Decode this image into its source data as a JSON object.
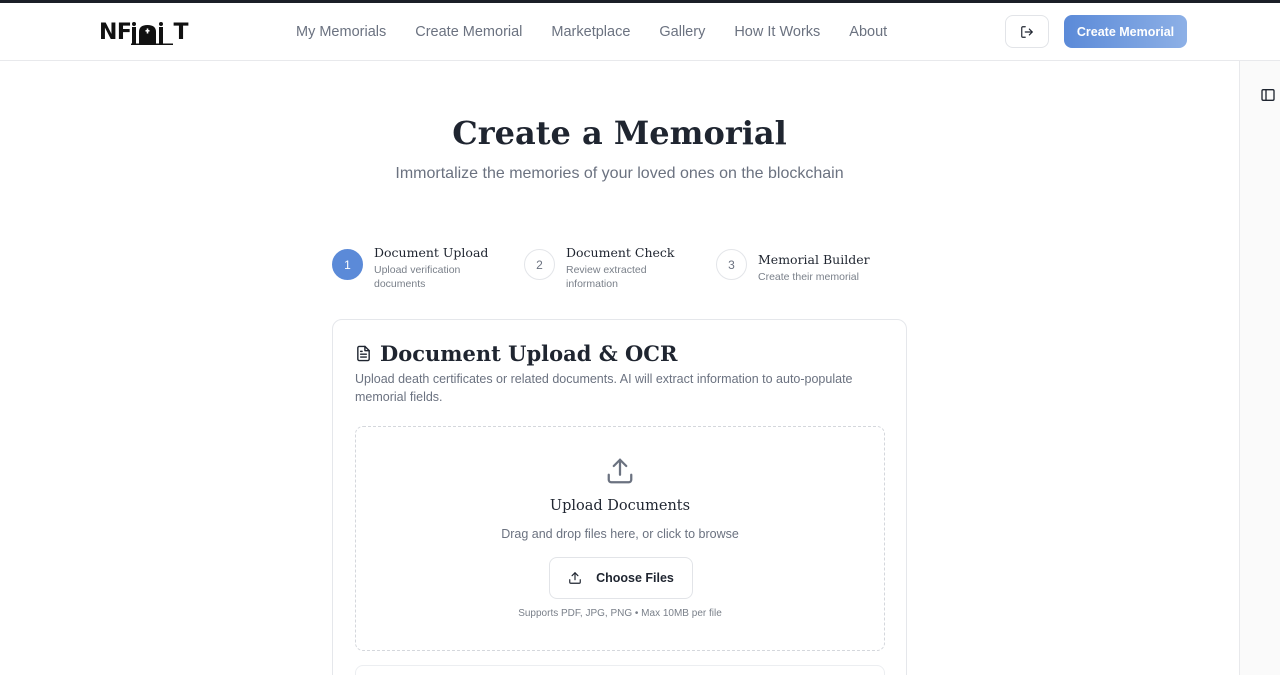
{
  "app": {
    "logo_text_left": "NF",
    "logo_text_right": "T"
  },
  "nav": {
    "items": [
      {
        "label": "My Memorials"
      },
      {
        "label": "Create Memorial"
      },
      {
        "label": "Marketplace"
      },
      {
        "label": "Gallery"
      },
      {
        "label": "How It Works"
      },
      {
        "label": "About"
      }
    ]
  },
  "header": {
    "cta_label": "Create Memorial"
  },
  "hero": {
    "title": "Create a Memorial",
    "subtitle": "Immortalize the memories of your loved ones on the blockchain"
  },
  "steps": [
    {
      "number": "1",
      "title": "Document Upload",
      "desc_line1": "Upload verification",
      "desc_line2": "documents",
      "active": true
    },
    {
      "number": "2",
      "title": "Document Check",
      "desc_line1": "Review extracted",
      "desc_line2": "information",
      "active": false
    },
    {
      "number": "3",
      "title": "Memorial Builder",
      "desc_line1": "Create their memorial",
      "desc_line2": "",
      "active": false
    }
  ],
  "card": {
    "title": "Document Upload & OCR",
    "description": "Upload death certificates or related documents. AI will extract information to auto-populate memorial fields.",
    "dropzone": {
      "title": "Upload Documents",
      "subtitle": "Drag and drop files here, or click to browse",
      "button_label": "Choose Files",
      "note": "Supports PDF, JPG, PNG • Max 10MB per file"
    }
  },
  "colors": {
    "accent": "#5b8ad8",
    "text": "#1f2530",
    "muted": "#6b7280",
    "border": "#e5e7eb"
  },
  "icons": {
    "logout": "logout-icon",
    "sidebar": "sidebar-toggle-icon",
    "document": "document-icon",
    "upload": "upload-icon"
  }
}
